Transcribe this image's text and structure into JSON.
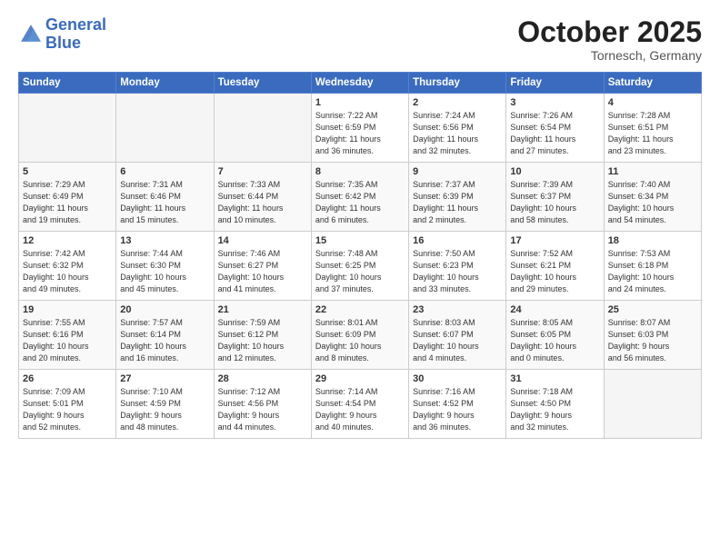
{
  "header": {
    "logo_general": "General",
    "logo_blue": "Blue",
    "month": "October 2025",
    "location": "Tornesch, Germany"
  },
  "weekdays": [
    "Sunday",
    "Monday",
    "Tuesday",
    "Wednesday",
    "Thursday",
    "Friday",
    "Saturday"
  ],
  "weeks": [
    [
      {
        "day": "",
        "info": ""
      },
      {
        "day": "",
        "info": ""
      },
      {
        "day": "",
        "info": ""
      },
      {
        "day": "1",
        "info": "Sunrise: 7:22 AM\nSunset: 6:59 PM\nDaylight: 11 hours\nand 36 minutes."
      },
      {
        "day": "2",
        "info": "Sunrise: 7:24 AM\nSunset: 6:56 PM\nDaylight: 11 hours\nand 32 minutes."
      },
      {
        "day": "3",
        "info": "Sunrise: 7:26 AM\nSunset: 6:54 PM\nDaylight: 11 hours\nand 27 minutes."
      },
      {
        "day": "4",
        "info": "Sunrise: 7:28 AM\nSunset: 6:51 PM\nDaylight: 11 hours\nand 23 minutes."
      }
    ],
    [
      {
        "day": "5",
        "info": "Sunrise: 7:29 AM\nSunset: 6:49 PM\nDaylight: 11 hours\nand 19 minutes."
      },
      {
        "day": "6",
        "info": "Sunrise: 7:31 AM\nSunset: 6:46 PM\nDaylight: 11 hours\nand 15 minutes."
      },
      {
        "day": "7",
        "info": "Sunrise: 7:33 AM\nSunset: 6:44 PM\nDaylight: 11 hours\nand 10 minutes."
      },
      {
        "day": "8",
        "info": "Sunrise: 7:35 AM\nSunset: 6:42 PM\nDaylight: 11 hours\nand 6 minutes."
      },
      {
        "day": "9",
        "info": "Sunrise: 7:37 AM\nSunset: 6:39 PM\nDaylight: 11 hours\nand 2 minutes."
      },
      {
        "day": "10",
        "info": "Sunrise: 7:39 AM\nSunset: 6:37 PM\nDaylight: 10 hours\nand 58 minutes."
      },
      {
        "day": "11",
        "info": "Sunrise: 7:40 AM\nSunset: 6:34 PM\nDaylight: 10 hours\nand 54 minutes."
      }
    ],
    [
      {
        "day": "12",
        "info": "Sunrise: 7:42 AM\nSunset: 6:32 PM\nDaylight: 10 hours\nand 49 minutes."
      },
      {
        "day": "13",
        "info": "Sunrise: 7:44 AM\nSunset: 6:30 PM\nDaylight: 10 hours\nand 45 minutes."
      },
      {
        "day": "14",
        "info": "Sunrise: 7:46 AM\nSunset: 6:27 PM\nDaylight: 10 hours\nand 41 minutes."
      },
      {
        "day": "15",
        "info": "Sunrise: 7:48 AM\nSunset: 6:25 PM\nDaylight: 10 hours\nand 37 minutes."
      },
      {
        "day": "16",
        "info": "Sunrise: 7:50 AM\nSunset: 6:23 PM\nDaylight: 10 hours\nand 33 minutes."
      },
      {
        "day": "17",
        "info": "Sunrise: 7:52 AM\nSunset: 6:21 PM\nDaylight: 10 hours\nand 29 minutes."
      },
      {
        "day": "18",
        "info": "Sunrise: 7:53 AM\nSunset: 6:18 PM\nDaylight: 10 hours\nand 24 minutes."
      }
    ],
    [
      {
        "day": "19",
        "info": "Sunrise: 7:55 AM\nSunset: 6:16 PM\nDaylight: 10 hours\nand 20 minutes."
      },
      {
        "day": "20",
        "info": "Sunrise: 7:57 AM\nSunset: 6:14 PM\nDaylight: 10 hours\nand 16 minutes."
      },
      {
        "day": "21",
        "info": "Sunrise: 7:59 AM\nSunset: 6:12 PM\nDaylight: 10 hours\nand 12 minutes."
      },
      {
        "day": "22",
        "info": "Sunrise: 8:01 AM\nSunset: 6:09 PM\nDaylight: 10 hours\nand 8 minutes."
      },
      {
        "day": "23",
        "info": "Sunrise: 8:03 AM\nSunset: 6:07 PM\nDaylight: 10 hours\nand 4 minutes."
      },
      {
        "day": "24",
        "info": "Sunrise: 8:05 AM\nSunset: 6:05 PM\nDaylight: 10 hours\nand 0 minutes."
      },
      {
        "day": "25",
        "info": "Sunrise: 8:07 AM\nSunset: 6:03 PM\nDaylight: 9 hours\nand 56 minutes."
      }
    ],
    [
      {
        "day": "26",
        "info": "Sunrise: 7:09 AM\nSunset: 5:01 PM\nDaylight: 9 hours\nand 52 minutes."
      },
      {
        "day": "27",
        "info": "Sunrise: 7:10 AM\nSunset: 4:59 PM\nDaylight: 9 hours\nand 48 minutes."
      },
      {
        "day": "28",
        "info": "Sunrise: 7:12 AM\nSunset: 4:56 PM\nDaylight: 9 hours\nand 44 minutes."
      },
      {
        "day": "29",
        "info": "Sunrise: 7:14 AM\nSunset: 4:54 PM\nDaylight: 9 hours\nand 40 minutes."
      },
      {
        "day": "30",
        "info": "Sunrise: 7:16 AM\nSunset: 4:52 PM\nDaylight: 9 hours\nand 36 minutes."
      },
      {
        "day": "31",
        "info": "Sunrise: 7:18 AM\nSunset: 4:50 PM\nDaylight: 9 hours\nand 32 minutes."
      },
      {
        "day": "",
        "info": ""
      }
    ]
  ]
}
